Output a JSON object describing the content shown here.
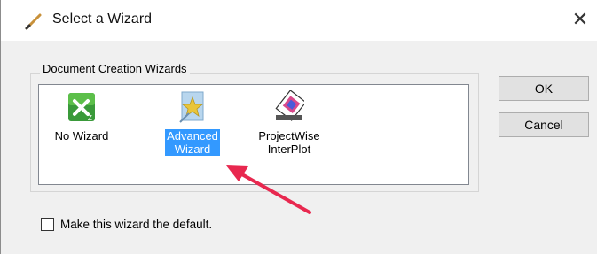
{
  "window": {
    "title": "Select a Wizard",
    "close_glyph": "✕",
    "title_icon": "pencil-icon"
  },
  "group": {
    "label": "Document Creation Wizards",
    "items": [
      {
        "label_line1": "No Wizard",
        "label_line2": "",
        "icon": "no-wizard-icon",
        "selected": false
      },
      {
        "label_line1": "Advanced",
        "label_line2": "Wizard",
        "icon": "advanced-wizard-icon",
        "selected": true
      },
      {
        "label_line1": "ProjectWise",
        "label_line2": "InterPlot",
        "icon": "projectwise-interplot-icon",
        "selected": false
      }
    ]
  },
  "buttons": {
    "ok": "OK",
    "cancel": "Cancel"
  },
  "default_checkbox": {
    "label": "Make this wizard the default.",
    "checked": false
  },
  "colors": {
    "selection": "#3399ff",
    "annotation_arrow": "#e8284f"
  }
}
